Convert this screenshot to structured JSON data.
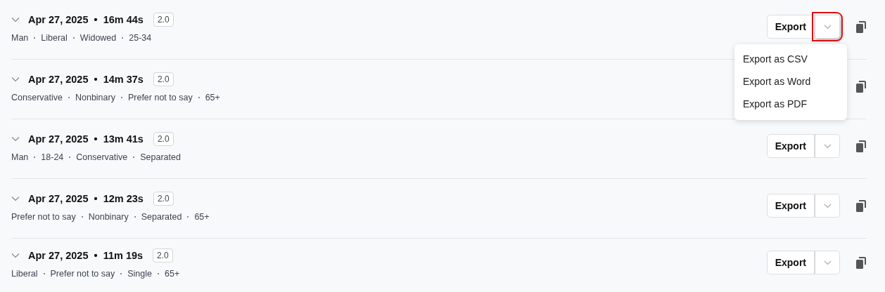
{
  "sessions": [
    {
      "date": "Apr 27, 2025",
      "separator": "•",
      "duration": "16m 44s",
      "version": "2.0",
      "tags": [
        "Man",
        "Liberal",
        "Widowed",
        "25-34"
      ],
      "export_label": "Export",
      "toggle_highlighted": true,
      "menu": [
        "Export as CSV",
        "Export as Word",
        "Export as PDF"
      ]
    },
    {
      "date": "Apr 27, 2025",
      "separator": "•",
      "duration": "14m 37s",
      "version": "2.0",
      "tags": [
        "Conservative",
        "Nonbinary",
        "Prefer not to say",
        "65+"
      ]
    },
    {
      "date": "Apr 27, 2025",
      "separator": "•",
      "duration": "13m 41s",
      "version": "2.0",
      "tags": [
        "Man",
        "18-24",
        "Conservative",
        "Separated"
      ],
      "export_label": "Export"
    },
    {
      "date": "Apr 27, 2025",
      "separator": "•",
      "duration": "12m 23s",
      "version": "2.0",
      "tags": [
        "Prefer not to say",
        "Nonbinary",
        "Separated",
        "65+"
      ],
      "export_label": "Export"
    },
    {
      "date": "Apr 27, 2025",
      "separator": "•",
      "duration": "11m 19s",
      "version": "2.0",
      "tags": [
        "Liberal",
        "Prefer not to say",
        "Single",
        "65+"
      ],
      "export_label": "Export"
    }
  ]
}
